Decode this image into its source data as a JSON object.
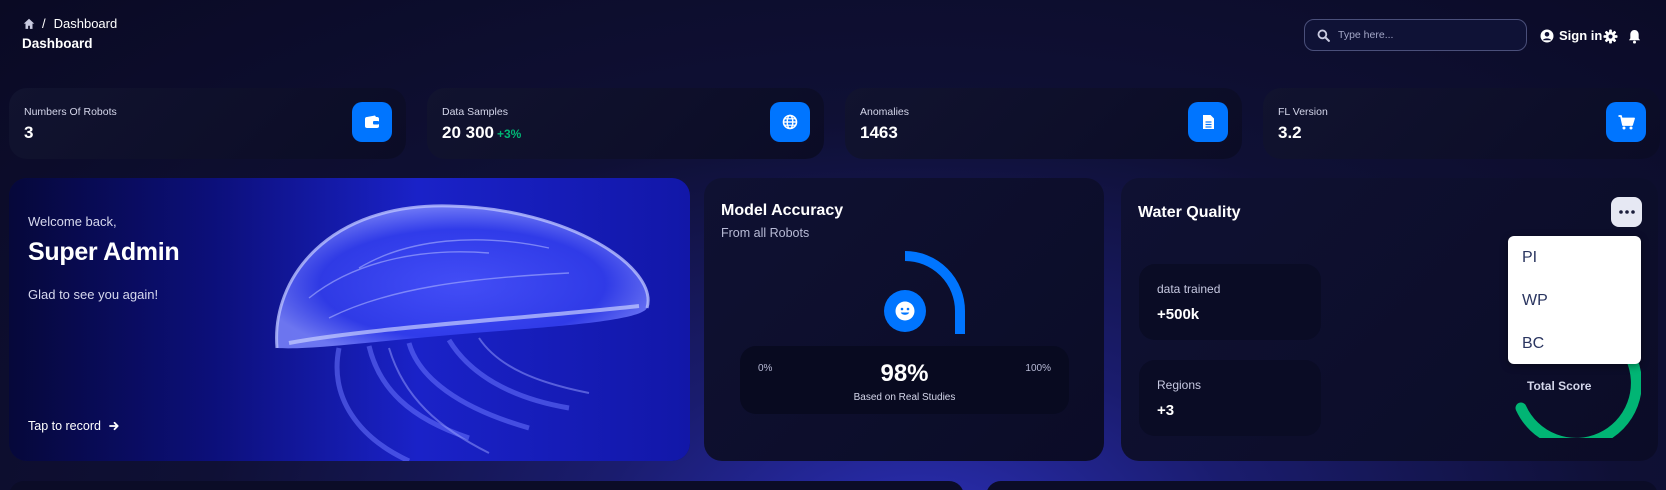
{
  "breadcrumb": {
    "current": "Dashboard",
    "separator": "/"
  },
  "page_title": "Dashboard",
  "search": {
    "placeholder": "Type here...",
    "value": ""
  },
  "header": {
    "signin_label": "Sign in"
  },
  "icons": {
    "home": "home-icon",
    "search": "search-icon",
    "user": "user-circle-icon",
    "gear": "gear-icon",
    "bell": "bell-icon",
    "wallet": "wallet-icon",
    "globe": "globe-icon",
    "document": "document-icon",
    "cart": "cart-icon",
    "smile": "smile-icon",
    "arrow": "arrow-right-icon",
    "more": "more-dots-icon"
  },
  "stats": [
    {
      "label": "Numbers Of Robots",
      "value": "3",
      "delta": ""
    },
    {
      "label": "Data Samples",
      "value": "20 300",
      "delta": "+3%"
    },
    {
      "label": "Anomalies",
      "value": "1463",
      "delta": ""
    },
    {
      "label": "FL Version",
      "value": "3.2",
      "delta": ""
    }
  ],
  "welcome": {
    "greeting": "Welcome back,",
    "name": "Super Admin",
    "subtitle": "Glad to see you again!",
    "action": "Tap to record"
  },
  "model_accuracy": {
    "title": "Model Accuracy",
    "subtitle": "From all Robots",
    "min_label": "0%",
    "max_label": "100%",
    "value": "98%",
    "value_fraction": 0.98,
    "note": "Based on Real Studies"
  },
  "water_quality": {
    "title": "Water Quality",
    "metrics": [
      {
        "label": "data trained",
        "value": "+500k"
      },
      {
        "label": "Regions",
        "value": "+3"
      }
    ],
    "total_label": "Total Score",
    "menu_items": [
      "PI",
      "WP",
      "BC"
    ]
  },
  "colors": {
    "accent": "#0075ff",
    "positive": "#01b574",
    "gauge": "#01b574"
  }
}
